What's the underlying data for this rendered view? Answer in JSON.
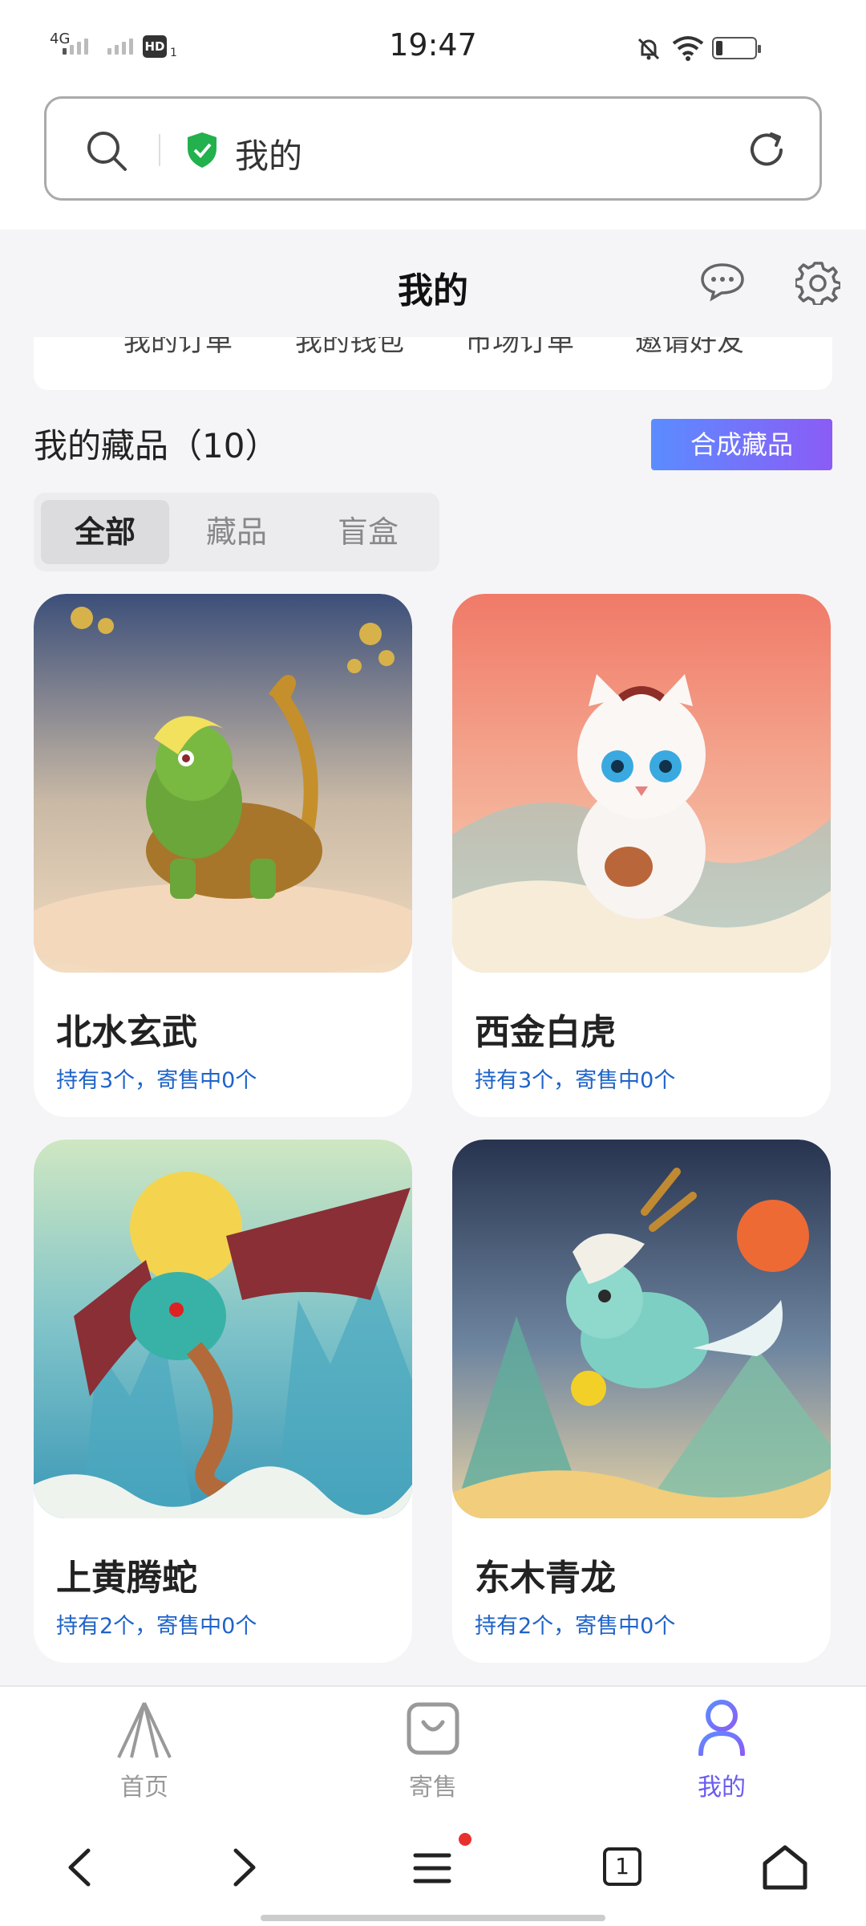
{
  "status_bar": {
    "time": "19:47",
    "net1": "4G",
    "hd": "HD",
    "sim": "1"
  },
  "url_bar": {
    "title": "我的"
  },
  "page": {
    "title": "我的"
  },
  "menu_items": [
    "我的订单",
    "我的钱包",
    "市场订单",
    "邀请好友"
  ],
  "collection": {
    "heading": "我的藏品（10）",
    "synth_button": "合成藏品"
  },
  "tabs": [
    {
      "label": "全部",
      "active": true
    },
    {
      "label": "藏品",
      "active": false
    },
    {
      "label": "盲盒",
      "active": false
    }
  ],
  "items": [
    {
      "name": "北水玄武",
      "holding": "持有3个，寄售中0个"
    },
    {
      "name": "西金白虎",
      "holding": "持有3个，寄售中0个"
    },
    {
      "name": "上黄腾蛇",
      "holding": "持有2个，寄售中0个"
    },
    {
      "name": "东木青龙",
      "holding": "持有2个，寄售中0个"
    }
  ],
  "bottom_nav": [
    {
      "label": "首页",
      "icon": "home-a-icon",
      "active": false
    },
    {
      "label": "寄售",
      "icon": "bag-icon",
      "active": false
    },
    {
      "label": "我的",
      "icon": "user-icon",
      "active": true
    }
  ],
  "browser": {
    "tab_count": "1"
  },
  "colors": {
    "accent": "#6a5cf0",
    "link": "#1e63c9",
    "shield": "#22b14c"
  }
}
